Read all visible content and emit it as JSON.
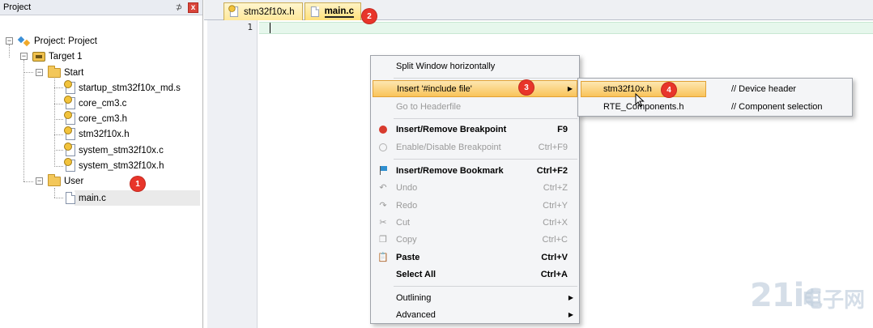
{
  "project_panel": {
    "title": "Project",
    "pin": "⊅",
    "close": "x",
    "tree": {
      "project": "Project: Project",
      "target": "Target 1",
      "group_start": "Start",
      "start_files": [
        "startup_stm32f10x_md.s",
        "core_cm3.c",
        "core_cm3.h",
        "stm32f10x.h",
        "system_stm32f10x.c",
        "system_stm32f10x.h"
      ],
      "group_user": "User",
      "user_files": [
        "main.c"
      ]
    }
  },
  "editor": {
    "tabs": [
      {
        "label": "stm32f10x.h"
      },
      {
        "label": "main.c"
      }
    ],
    "line_number": "1"
  },
  "context_menu": {
    "items": [
      {
        "label": "Split Window horizontally",
        "shortcut": ""
      },
      {
        "label": "Insert '#include file'",
        "shortcut": ""
      },
      {
        "label": "Go to Headerfile",
        "shortcut": ""
      },
      {
        "label": "Insert/Remove Breakpoint",
        "shortcut": "F9"
      },
      {
        "label": "Enable/Disable Breakpoint",
        "shortcut": "Ctrl+F9"
      },
      {
        "label": "Insert/Remove Bookmark",
        "shortcut": "Ctrl+F2"
      },
      {
        "label": "Undo",
        "shortcut": "Ctrl+Z"
      },
      {
        "label": "Redo",
        "shortcut": "Ctrl+Y"
      },
      {
        "label": "Cut",
        "shortcut": "Ctrl+X"
      },
      {
        "label": "Copy",
        "shortcut": "Ctrl+C"
      },
      {
        "label": "Paste",
        "shortcut": "Ctrl+V"
      },
      {
        "label": "Select All",
        "shortcut": "Ctrl+A"
      },
      {
        "label": "Outlining",
        "shortcut": ""
      },
      {
        "label": "Advanced",
        "shortcut": ""
      }
    ]
  },
  "submenu": {
    "items": [
      {
        "name": "stm32f10x.h",
        "description": "// Device header"
      },
      {
        "name": "RTE_Components.h",
        "description": "// Component selection"
      }
    ]
  },
  "badges": [
    "1",
    "2",
    "3",
    "4"
  ],
  "watermark": {
    "logo": "21ic",
    "text": "电子网"
  },
  "colors": {
    "highlight": "#f9c35a",
    "badge": "#e8352a",
    "current_line": "#e6f7ec",
    "breakpoint": "#d83b2e"
  }
}
